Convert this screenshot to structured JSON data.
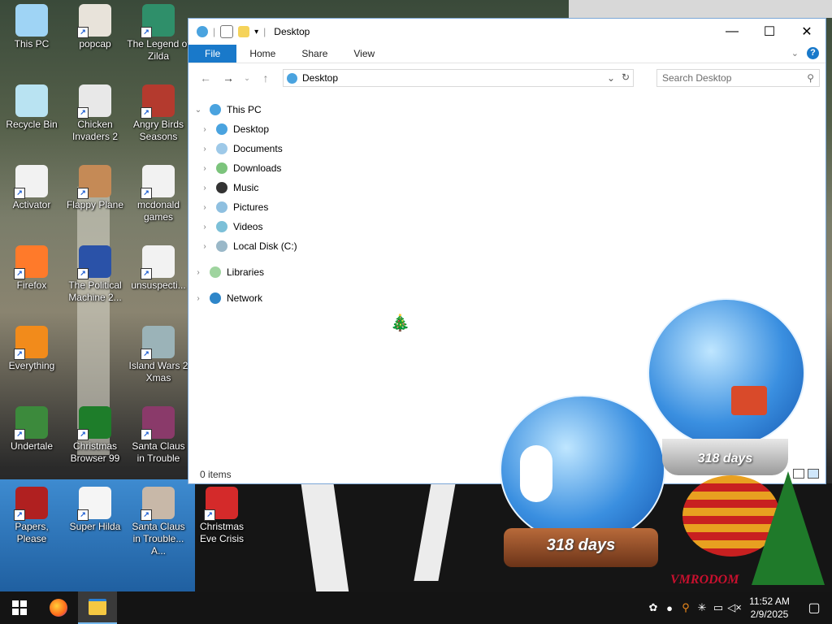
{
  "desktop": {
    "icons": [
      {
        "label": "This PC",
        "color": "#9fd4f5"
      },
      {
        "label": "popcap",
        "color": "#e8e3da"
      },
      {
        "label": "The Legend of Zilda",
        "color": "#2f8f6a"
      },
      {
        "label": "Recycle Bin",
        "color": "#b9e3f2"
      },
      {
        "label": "Chicken Invaders 2",
        "color": "#e8e8e8"
      },
      {
        "label": "Angry Birds Seasons",
        "color": "#b43a2e"
      },
      {
        "label": "Activator",
        "color": "#f2f2f2"
      },
      {
        "label": "Flappy Plane",
        "color": "#c58a56"
      },
      {
        "label": "mcdonald games",
        "color": "#f2f2f2"
      },
      {
        "label": "Firefox",
        "color": "#ff7a2a"
      },
      {
        "label": "The Political Machine 2...",
        "color": "#2a52a8"
      },
      {
        "label": "unsuspecti...",
        "color": "#f2f2f2"
      },
      {
        "label": "Everything",
        "color": "#f28b1b"
      },
      {
        "label": "Island Wars 2 Xmas",
        "color": "#9bb3b8"
      },
      {
        "label": "Undertale",
        "color": "#3c8a3c"
      },
      {
        "label": "Christmas Browser 99",
        "color": "#1e7d2a"
      },
      {
        "label": "Santa Claus in Trouble",
        "color": "#8a3a6a"
      },
      {
        "label": "Papers, Please",
        "color": "#b02020"
      },
      {
        "label": "Super Hilda",
        "color": "#f5f5f5"
      },
      {
        "label": "Santa Claus in Trouble... A...",
        "color": "#c8b8a8"
      },
      {
        "label": "Christmas Eve Crisis",
        "color": "#d42a2a"
      }
    ]
  },
  "explorer": {
    "title": "Desktop",
    "tabs": {
      "file": "File",
      "home": "Home",
      "share": "Share",
      "view": "View"
    },
    "address": "Desktop",
    "search_placeholder": "Search Desktop",
    "tree": {
      "this_pc": "This PC",
      "children": [
        "Desktop",
        "Documents",
        "Downloads",
        "Music",
        "Pictures",
        "Videos",
        "Local Disk (C:)"
      ],
      "libraries": "Libraries",
      "network": "Network"
    },
    "status": "0 items"
  },
  "globes": {
    "left_label": "318 days",
    "right_label": "318 days"
  },
  "watermark": "VMRODOM",
  "taskbar": {
    "time": "11:52 AM",
    "date": "2/9/2025"
  }
}
